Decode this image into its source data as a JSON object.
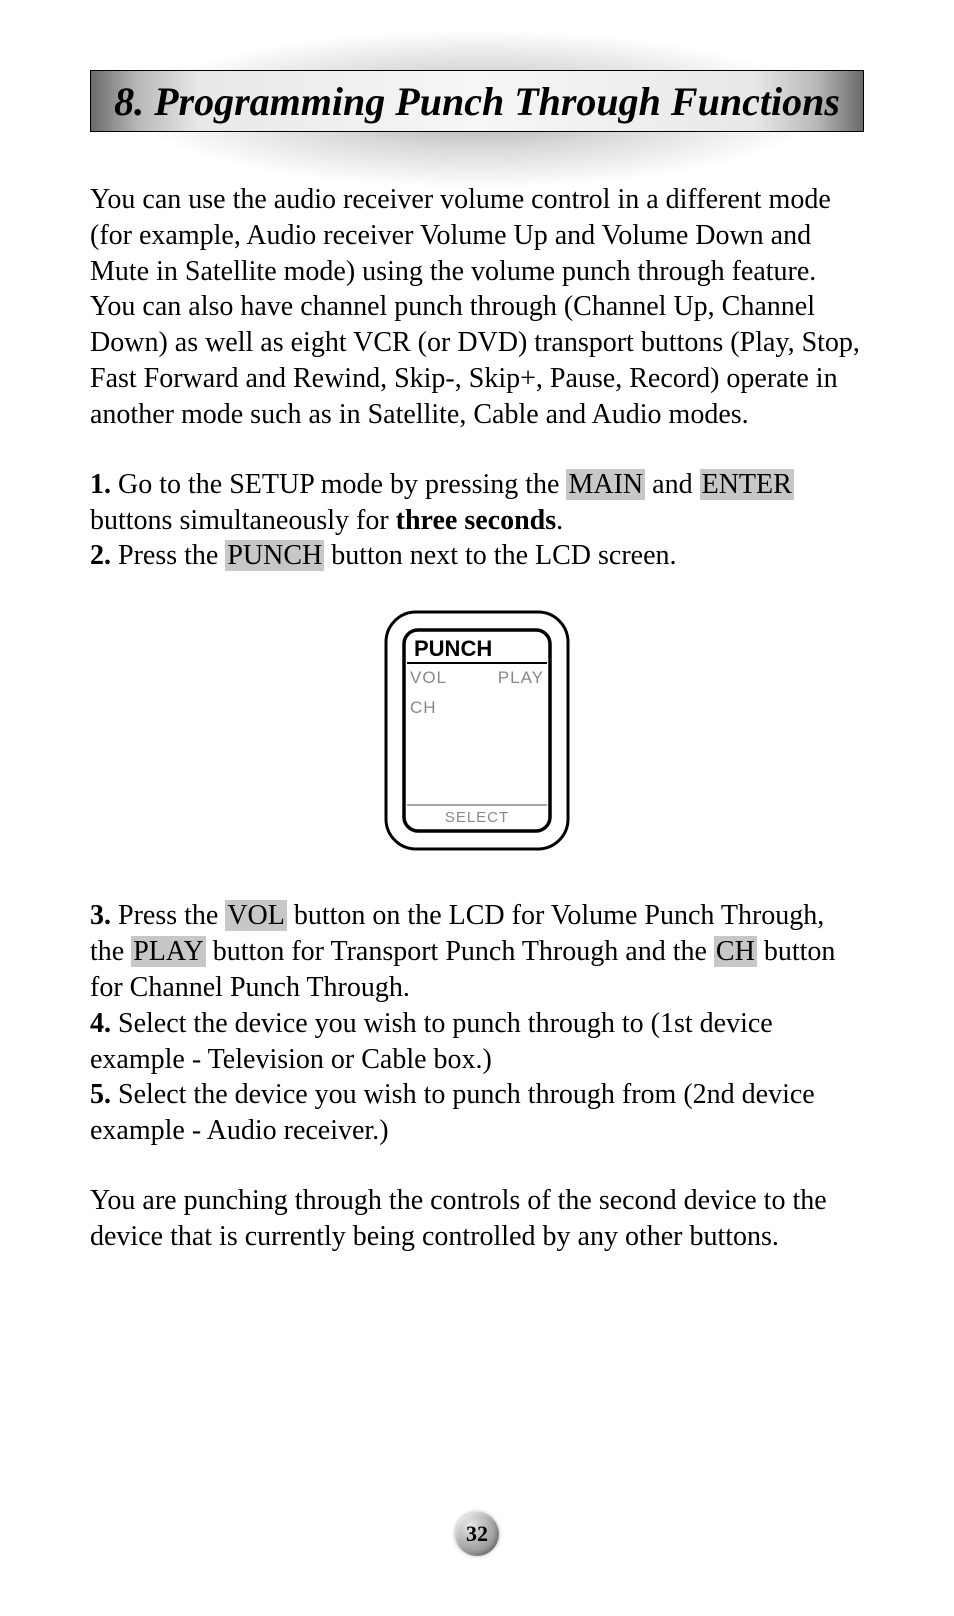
{
  "header": {
    "title": "8. Programming Punch Through Functions"
  },
  "intro": "You can use the audio receiver volume control in a different mode (for example, Audio receiver Volume Up and Volume Down and Mute in Satellite mode) using the volume punch through feature. You can also have channel punch through (Channel Up, Channel Down) as well as eight VCR (or DVD) transport buttons (Play, Stop, Fast Forward and Rewind, Skip-, Skip+, Pause, Record) operate in another mode such as in Satellite, Cable and Audio modes.",
  "steps": {
    "s1_num": "1.",
    "s1_a": " Go to the SETUP mode by pressing the ",
    "s1_main": "MAIN",
    "s1_b": " and ",
    "s1_enter": "ENTER",
    "s1_c": " buttons simultaneously for ",
    "s1_bold": "three seconds",
    "s1_d": ".",
    "s2_num": "2.",
    "s2_a": " Press the ",
    "s2_punch": "PUNCH",
    "s2_b": " button next to the LCD screen.",
    "s3_num": "3.",
    "s3_a": " Press the ",
    "s3_vol": "VOL",
    "s3_b": " button on the LCD for Volume Punch Through, the ",
    "s3_play": "PLAY",
    "s3_c": " button for Transport Punch Through and the ",
    "s3_ch": "CH",
    "s3_d": " button for Channel Punch Through.",
    "s4_num": "4.",
    "s4_a": " Select the device you wish to punch through to (1st device example - Television or Cable box.)",
    "s5_num": "5.",
    "s5_a": " Select the device you wish to punch through from (2nd device example - Audio receiver.)"
  },
  "closing": "You are punching through the controls of the second device to the device that is currently being controlled by any other buttons.",
  "lcd": {
    "title": "PUNCH",
    "vol": "VOL",
    "play": "PLAY",
    "ch": "CH",
    "select": "SELECT"
  },
  "page_number": "32"
}
